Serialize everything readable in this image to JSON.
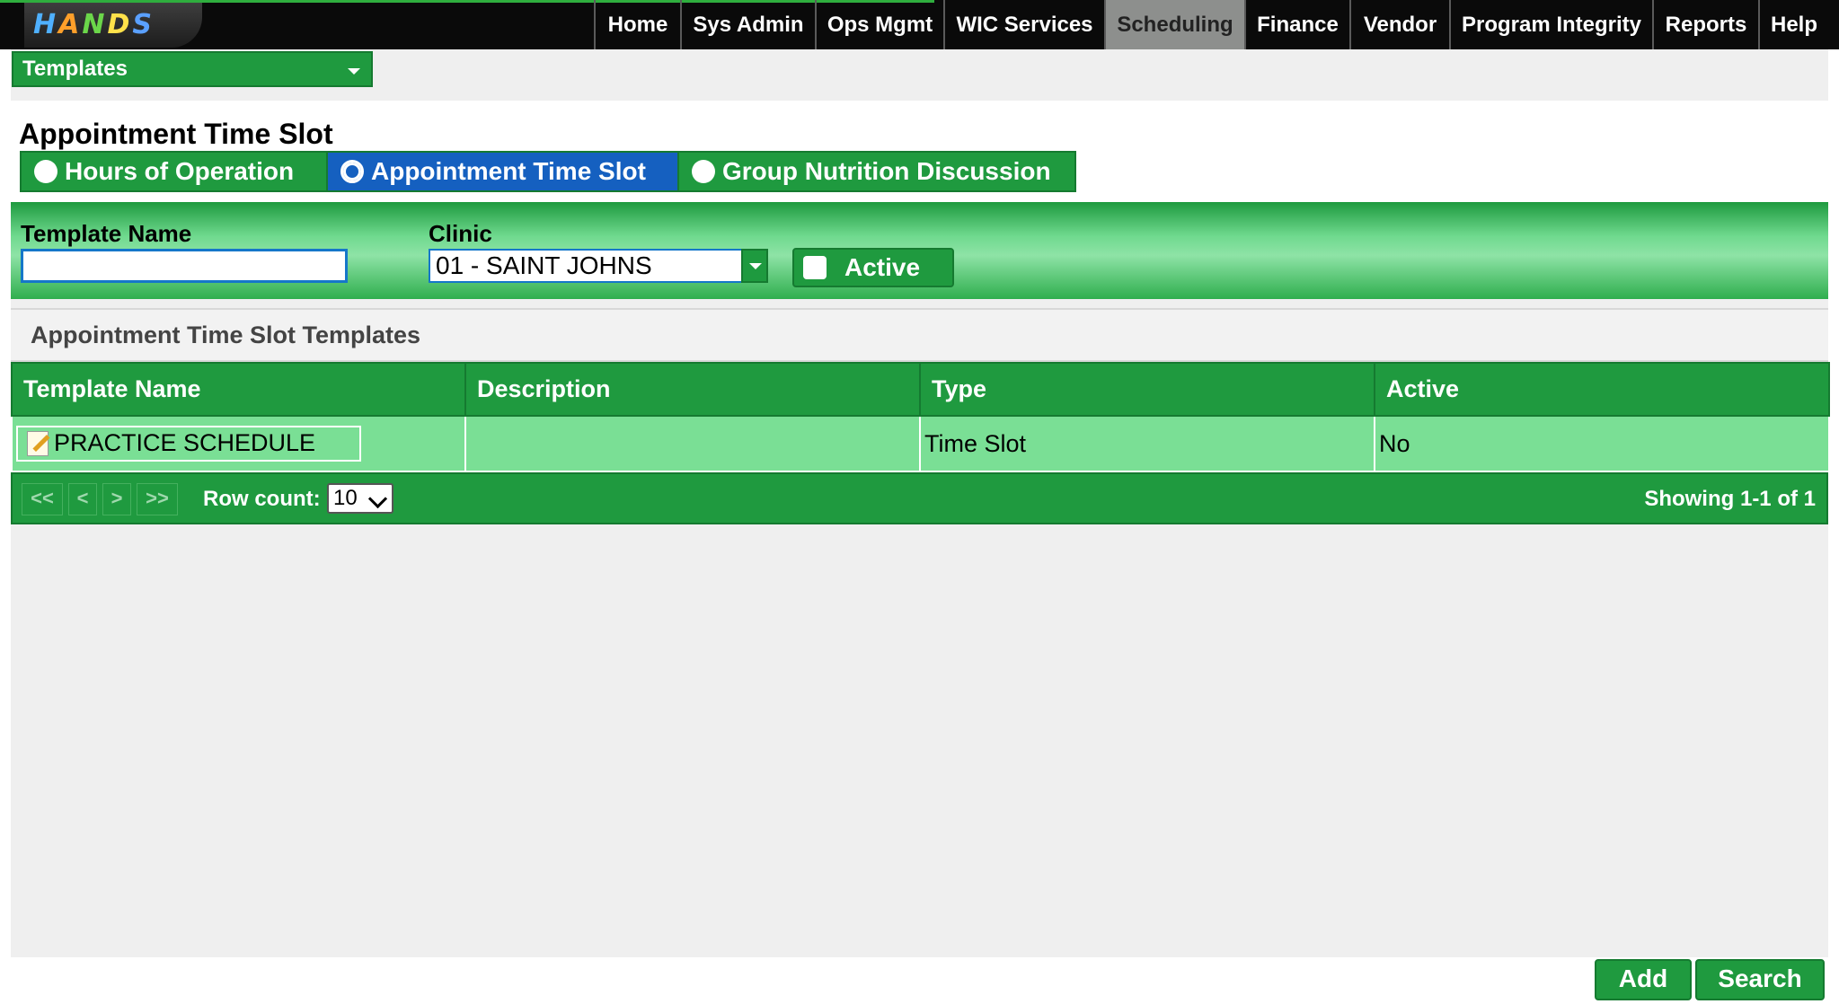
{
  "logo": {
    "letters": [
      "H",
      "A",
      "N",
      "D",
      "S"
    ],
    "colors": [
      "#4fb0ff",
      "#ff9f2a",
      "#6bd64a",
      "#ffe14a",
      "#5aa0ff"
    ]
  },
  "nav": {
    "items": [
      {
        "label": "Home"
      },
      {
        "label": "Sys Admin"
      },
      {
        "label": "Ops Mgmt"
      },
      {
        "label": "WIC Services"
      },
      {
        "label": "Scheduling",
        "active": true
      },
      {
        "label": "Finance"
      },
      {
        "label": "Vendor"
      },
      {
        "label": "Program Integrity"
      },
      {
        "label": "Reports"
      },
      {
        "label": "Help"
      }
    ]
  },
  "menu": {
    "selected": "Templates"
  },
  "page": {
    "title": "Appointment Time Slot"
  },
  "template_types": [
    {
      "label": "Hours of Operation",
      "selected": false
    },
    {
      "label": "Appointment Time Slot",
      "selected": true
    },
    {
      "label": "Group Nutrition Discussion",
      "selected": false
    }
  ],
  "filters": {
    "template_name_label": "Template Name",
    "template_name_value": "",
    "clinic_label": "Clinic",
    "clinic_value": "01 - SAINT JOHNS",
    "active_label": "Active",
    "active_checked": false
  },
  "grid": {
    "title": "Appointment Time Slot Templates",
    "columns": [
      "Template Name",
      "Description",
      "Type",
      "Active"
    ],
    "rows": [
      {
        "template_name": "PRACTICE SCHEDULE",
        "description": "",
        "type": "Time Slot",
        "active": "No"
      }
    ]
  },
  "pager": {
    "first": "<<",
    "prev": "<",
    "next": ">",
    "last": ">>",
    "row_count_label": "Row count:",
    "row_count_value": "10",
    "showing": "Showing 1-1 of 1"
  },
  "actions": {
    "add": "Add",
    "search": "Search"
  },
  "colors": {
    "green": "#1f9a3f",
    "light_green": "#7adf95",
    "selected_blue": "#1560c0",
    "nav_bg": "#0a0a0a"
  }
}
